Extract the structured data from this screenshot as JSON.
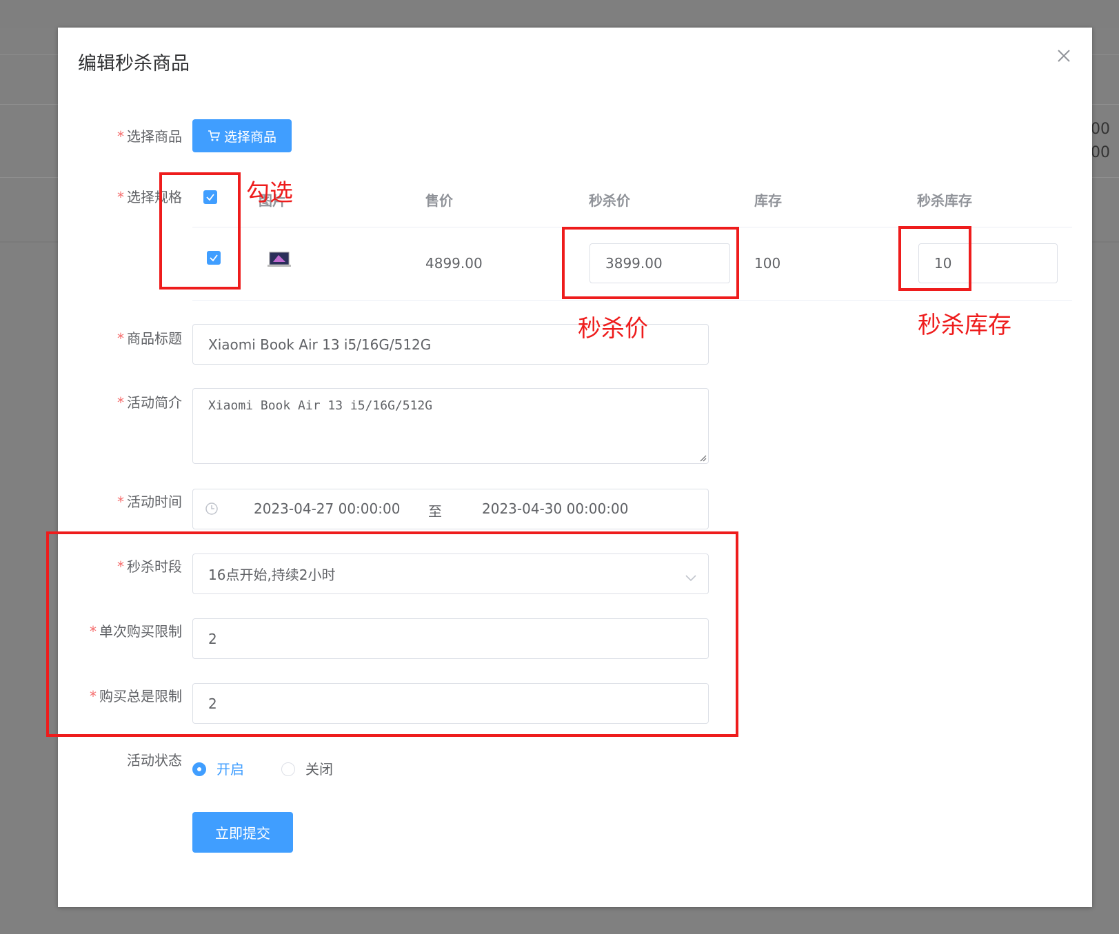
{
  "background": {
    "partial_values": [
      "00",
      "00"
    ]
  },
  "dialog": {
    "title": "编辑秒杀商品",
    "close_icon": "close-icon",
    "required_mark": "*"
  },
  "form": {
    "select_product": {
      "label": "选择商品",
      "button_label": "选择商品",
      "button_icon": "cart-icon"
    },
    "select_spec": {
      "label": "选择规格",
      "columns": [
        "图片",
        "售价",
        "秒杀价",
        "库存",
        "秒杀库存"
      ],
      "rows": [
        {
          "checked": true,
          "image_icon": "laptop-thumbnail",
          "price": "4899.00",
          "seckill_price": "3899.00",
          "stock": "100",
          "seckill_stock": "10"
        }
      ],
      "header_checked": true
    },
    "title": {
      "label": "商品标题",
      "value": "Xiaomi Book Air 13 i5/16G/512G"
    },
    "intro": {
      "label": "活动简介",
      "value": "Xiaomi Book Air 13 i5/16G/512G"
    },
    "time": {
      "label": "活动时间",
      "start": "2023-04-27 00:00:00",
      "separator": "至",
      "end": "2023-04-30 00:00:00",
      "icon": "clock-icon"
    },
    "period": {
      "label": "秒杀时段",
      "value": "16点开始,持续2小时",
      "icon": "chevron-down-icon"
    },
    "single_limit": {
      "label": "单次购买限制",
      "value": "2"
    },
    "total_limit": {
      "label": "购买总是限制",
      "value": "2"
    },
    "status": {
      "label": "活动状态",
      "options": [
        "开启",
        "关闭"
      ],
      "selected": "开启"
    },
    "submit_label": "立即提交"
  },
  "annotations": {
    "check": "勾选",
    "seckill_price": "秒杀价",
    "seckill_stock": "秒杀库存",
    "color": "#ee1c1c"
  },
  "colors": {
    "primary": "#409eff",
    "required": "#f56c6c",
    "overlay": "#808080"
  }
}
